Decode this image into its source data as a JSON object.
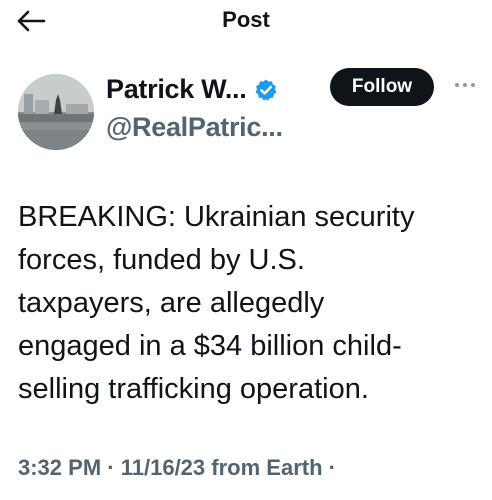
{
  "header": {
    "title": "Post",
    "back_icon": "arrow-left-icon"
  },
  "author": {
    "display_name": "Patrick W...",
    "handle": "@RealPatric...",
    "verified_icon": "verified-badge-icon",
    "verified_color": "#1d9bf0"
  },
  "actions": {
    "follow_label": "Follow",
    "more_icon": "more-horizontal-icon"
  },
  "tweet": {
    "lines": [
      "BREAKING: Ukrainian security",
      "forces, funded by U.S.",
      "taxpayers, are allegedly",
      "engaged in a $34 billion child-",
      "selling trafficking operation."
    ]
  },
  "meta": {
    "time": "3:32 PM",
    "date": "11/16/23",
    "source": "from Earth",
    "separator": "·"
  }
}
